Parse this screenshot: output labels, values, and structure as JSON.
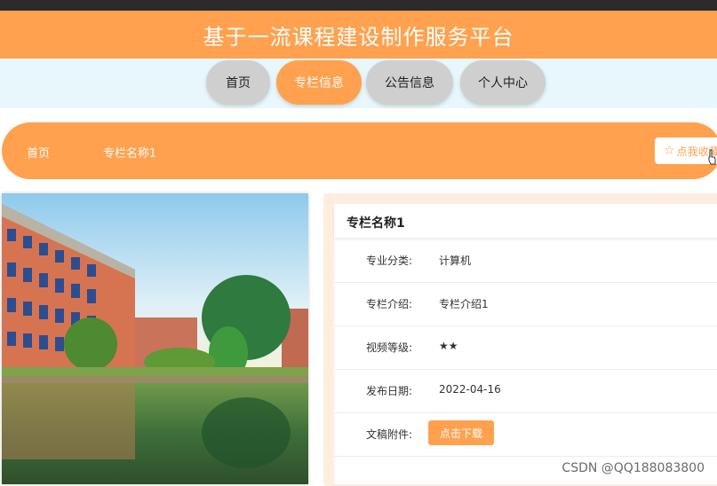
{
  "header": {
    "title": "基于一流课程建设制作服务平台"
  },
  "nav": [
    {
      "label": "首页",
      "active": false
    },
    {
      "label": "专栏信息",
      "active": true
    },
    {
      "label": "公告信息",
      "active": false
    },
    {
      "label": "个人中心",
      "active": false
    }
  ],
  "breadcrumb": {
    "home": "首页",
    "current": "专栏名称1"
  },
  "favorite": {
    "label": "点我收藏"
  },
  "detail": {
    "title": "专栏名称1",
    "rows": [
      {
        "label": "专业分类:",
        "value": "计算机"
      },
      {
        "label": "专栏介绍:",
        "value": "专栏介绍1"
      },
      {
        "label": "视频等级:",
        "value": "★★"
      },
      {
        "label": "发布日期:",
        "value": "2022-04-16"
      },
      {
        "label": "文稿附件:",
        "button": "点击下载"
      }
    ]
  },
  "watermark": "CSDN @QQ188083800",
  "colors": {
    "accent": "#ffa14e",
    "nav_bg": "#e8f7fb",
    "nav_inactive": "#cfcfcf"
  }
}
